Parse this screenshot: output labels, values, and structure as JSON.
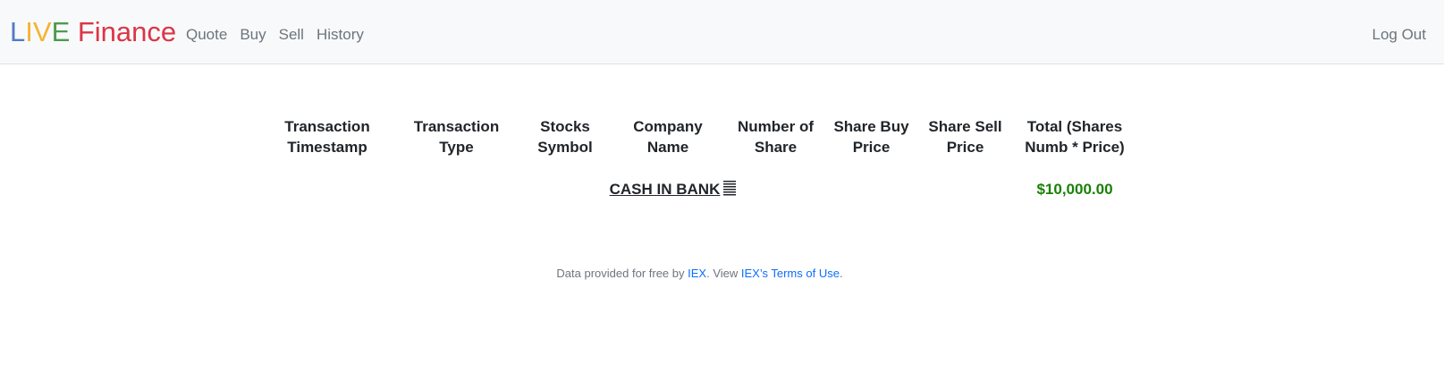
{
  "navbar": {
    "brand": {
      "letters": [
        {
          "text": "L",
          "color": "#537bc4"
        },
        {
          "text": "I",
          "color": "#f5b335"
        },
        {
          "text": "V",
          "color": "#f5b335"
        },
        {
          "text": "E",
          "color": "#4d9a4d"
        },
        {
          "text": " Finance",
          "color": "#dc3545"
        }
      ]
    },
    "links": [
      "Quote",
      "Buy",
      "Sell",
      "History"
    ],
    "logout_label": "Log Out"
  },
  "table": {
    "headers": [
      {
        "line1": "Transaction",
        "line2": "Timestamp"
      },
      {
        "line1": "Transaction",
        "line2": "Type"
      },
      {
        "line1": "Stocks",
        "line2": "Symbol"
      },
      {
        "line1": "Company",
        "line2": "Name"
      },
      {
        "line1": "Number of",
        "line2": "Share"
      },
      {
        "line1": "Share Buy",
        "line2": "Price"
      },
      {
        "line1": "Share Sell",
        "line2": "Price"
      },
      {
        "line1": "Total (Shares",
        "line2": "Numb * Price)"
      }
    ],
    "cash_row": {
      "label": "CASH IN BANK",
      "icon": "list-lines-icon",
      "total": "$10,000.00",
      "total_color": "#198005"
    }
  },
  "footer": {
    "prefix": "Data provided for free by ",
    "iex_link": "IEX",
    "middle": ". View ",
    "terms_link": "IEX’s Terms of Use",
    "suffix": "."
  }
}
